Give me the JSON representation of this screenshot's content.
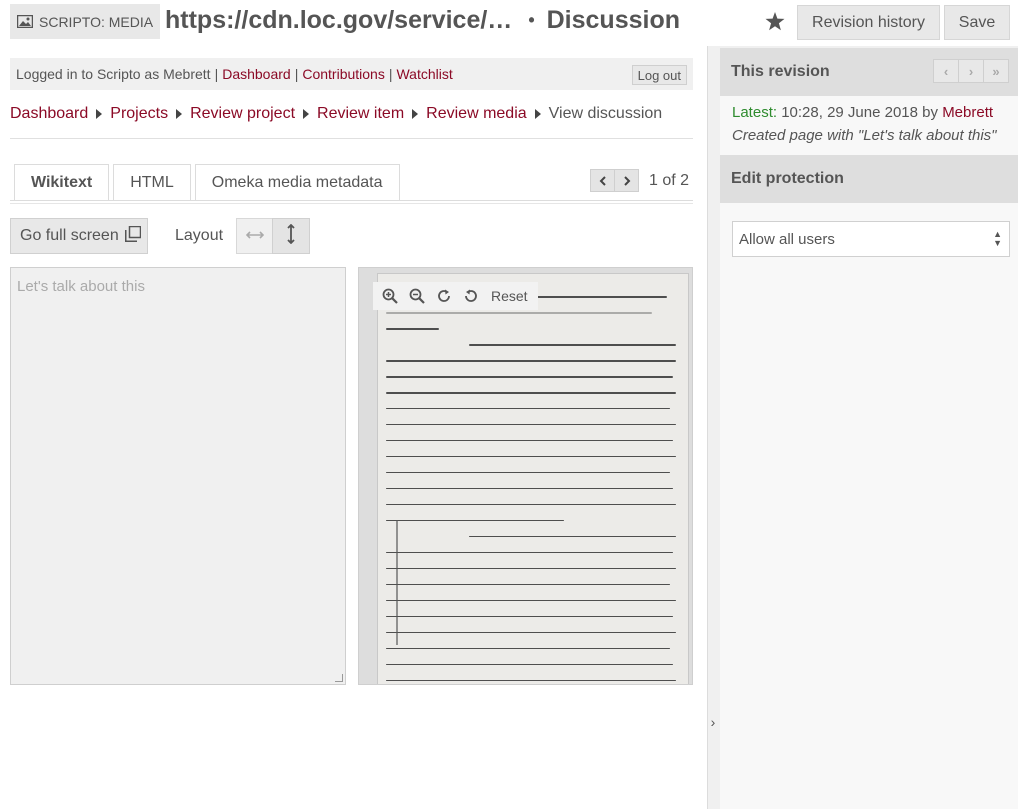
{
  "header": {
    "badge": "SCRIPTO: MEDIA",
    "title_url": "https://cdn.loc.gov/service/…",
    "title_separator": "•",
    "title_section": "Discussion",
    "revision_history_label": "Revision history",
    "save_label": "Save"
  },
  "login_bar": {
    "prefix": "Logged in to Scripto as Mebrett",
    "links": [
      "Dashboard",
      "Contributions",
      "Watchlist"
    ],
    "logout_label": "Log out"
  },
  "breadcrumbs": {
    "items": [
      "Dashboard",
      "Projects",
      "Review project",
      "Review item",
      "Review media"
    ],
    "current": "View discussion"
  },
  "tabs": {
    "items": [
      "Wikitext",
      "HTML",
      "Omeka media metadata"
    ],
    "active": "Wikitext"
  },
  "pager": {
    "count_text": "1 of 2"
  },
  "toolbar": {
    "fullscreen_label": "Go full screen",
    "layout_label": "Layout"
  },
  "editor": {
    "placeholder": "Let's talk about this"
  },
  "viewer": {
    "reset_label": "Reset"
  },
  "sidebar": {
    "revision_heading": "This revision",
    "latest_label": "Latest:",
    "revision_time": "10:28, 29 June 2018",
    "by_text": "by",
    "revision_user": "Mebrett",
    "revision_summary": "Created page with \"Let's talk about this\"",
    "protection_heading": "Edit protection",
    "protection_value": "Allow all users"
  },
  "colors": {
    "link": "#8b0a26",
    "latest": "#2e8b2e"
  }
}
